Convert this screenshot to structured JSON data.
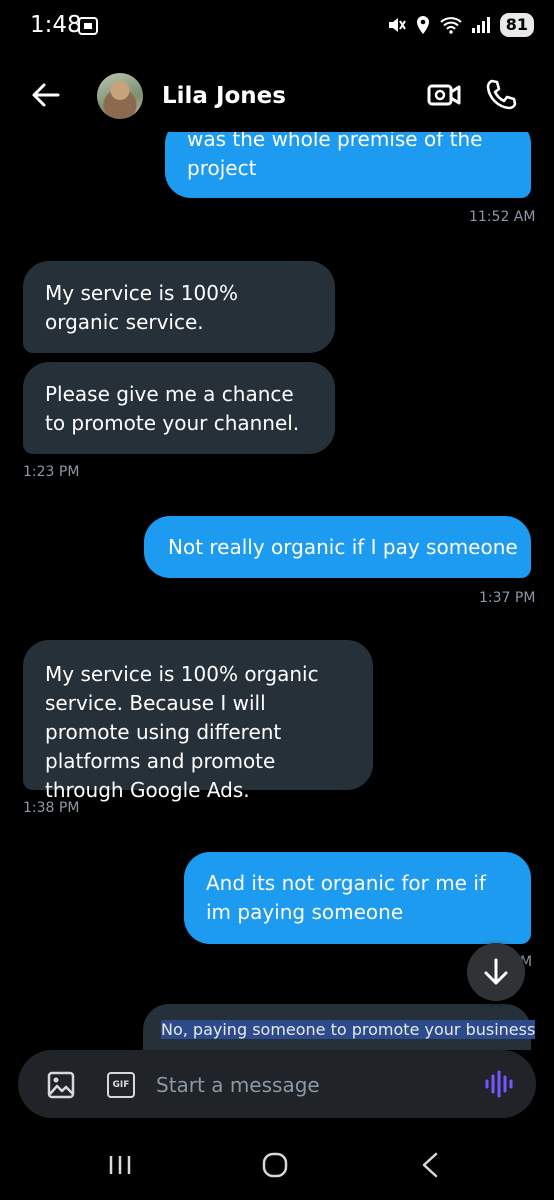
{
  "status_bar": {
    "time": "1:48",
    "battery": "81"
  },
  "header": {
    "contact_name": "Lila Jones"
  },
  "messages": [
    {
      "text": "was the whole premise of the project",
      "direction": "outgoing"
    },
    {
      "text": "My service is 100% organic service.",
      "direction": "incoming"
    },
    {
      "text": "Please give me a chance to promote your channel.",
      "direction": "incoming"
    },
    {
      "text": "Not really organic if I pay someone",
      "direction": "outgoing"
    },
    {
      "text": "My service is 100% organic service. Because I will promote using different platforms and promote through Google Ads.",
      "direction": "incoming"
    },
    {
      "text": "And its not organic for me if im paying someone",
      "direction": "outgoing"
    },
    {
      "text": "No, paying someone to promote your business",
      "direction": "outgoing"
    }
  ],
  "timestamps": [
    "11:52 AM",
    "1:23 PM",
    "1:37 PM",
    "1:38 PM",
    "M"
  ],
  "composer": {
    "placeholder": "Start a message",
    "gif_label": "GIF"
  },
  "colors": {
    "outgoing_bubble": "#1d9bf0",
    "incoming_bubble": "#263038",
    "background": "#000000",
    "voice_accent": "#7856ff"
  },
  "icons": [
    "back-arrow-icon",
    "video-call-icon",
    "phone-icon",
    "image-icon",
    "gif-icon",
    "voice-message-icon",
    "scroll-down-arrow-icon",
    "recents-icon",
    "home-icon",
    "nav-back-icon"
  ]
}
